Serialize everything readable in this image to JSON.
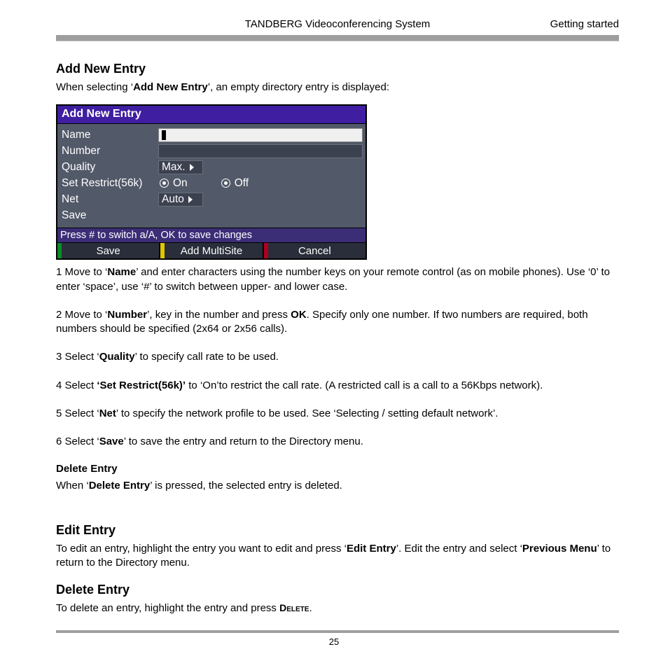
{
  "header": {
    "center": "TANDBERG Videoconferencing System",
    "right": "Getting started"
  },
  "section1": {
    "title": "Add New Entry",
    "intro_pre": "When selecting ‘",
    "intro_bold": "Add New Entry",
    "intro_post": "’, an empty directory entry is displayed:"
  },
  "dialog": {
    "title": "Add New Entry",
    "rows": {
      "name": "Name",
      "number": "Number",
      "quality": "Quality",
      "quality_value": "Max.",
      "restrict": "Set Restrict(56k)",
      "restrict_on": "On",
      "restrict_off": "Off",
      "net": "Net",
      "net_value": "Auto",
      "save": "Save"
    },
    "hint": "Press # to switch a/A, OK to save changes",
    "buttons": {
      "save": "Save",
      "multisite": "Add MultiSite",
      "cancel": "Cancel"
    }
  },
  "steps": {
    "s1a": "1    Move to ‘",
    "s1b": "Name",
    "s1c": "’ and enter characters using the number keys on your remote control (as on mobile phones). Use ‘0’ to enter ‘space’, use ‘#’ to switch between upper- and lower case.",
    "s2a": "2    Move to ‘",
    "s2b": "Number",
    "s2c": "’, key in the number and press ",
    "s2d": "OK",
    "s2e": ". Specify only one number. If two numbers are required, both numbers should be specified (2x64 or 2x56 calls).",
    "s3a": "3    Select ‘",
    "s3b": "Quality",
    "s3c": "’ to specify call rate to be used.",
    "s4a": "4     Select ",
    "s4b": "‘Set Restrict(56k)’",
    "s4c": " to ‘On’to restrict the call rate. (A restricted call is a call to a 56Kbps network).",
    "s5a": "5    Select ‘",
    "s5b": "Net",
    "s5c": "’ to specify the network profile to be used. See ‘Selecting / setting default network’.",
    "s6a": "6    Select ‘",
    "s6b": "Save",
    "s6c": "’ to save the entry and return to the Directory menu."
  },
  "delsub": {
    "title": "Delete Entry",
    "pre": "When ‘",
    "bold": "Delete Entry",
    "post": "’ is pressed, the selected entry is deleted."
  },
  "edit": {
    "title": "Edit Entry",
    "pre": "To edit an entry, highlight the entry you want to edit and press ‘",
    "bold1": "Edit Entry",
    "mid": "’. Edit the entry and select ‘",
    "bold2": "Previous Menu",
    "post": "’ to return to the Directory menu."
  },
  "delete2": {
    "title": "Delete Entry",
    "pre": "To delete an entry, highlight the entry and press ",
    "sc": "Delete",
    "post": "."
  },
  "page_number": "25"
}
